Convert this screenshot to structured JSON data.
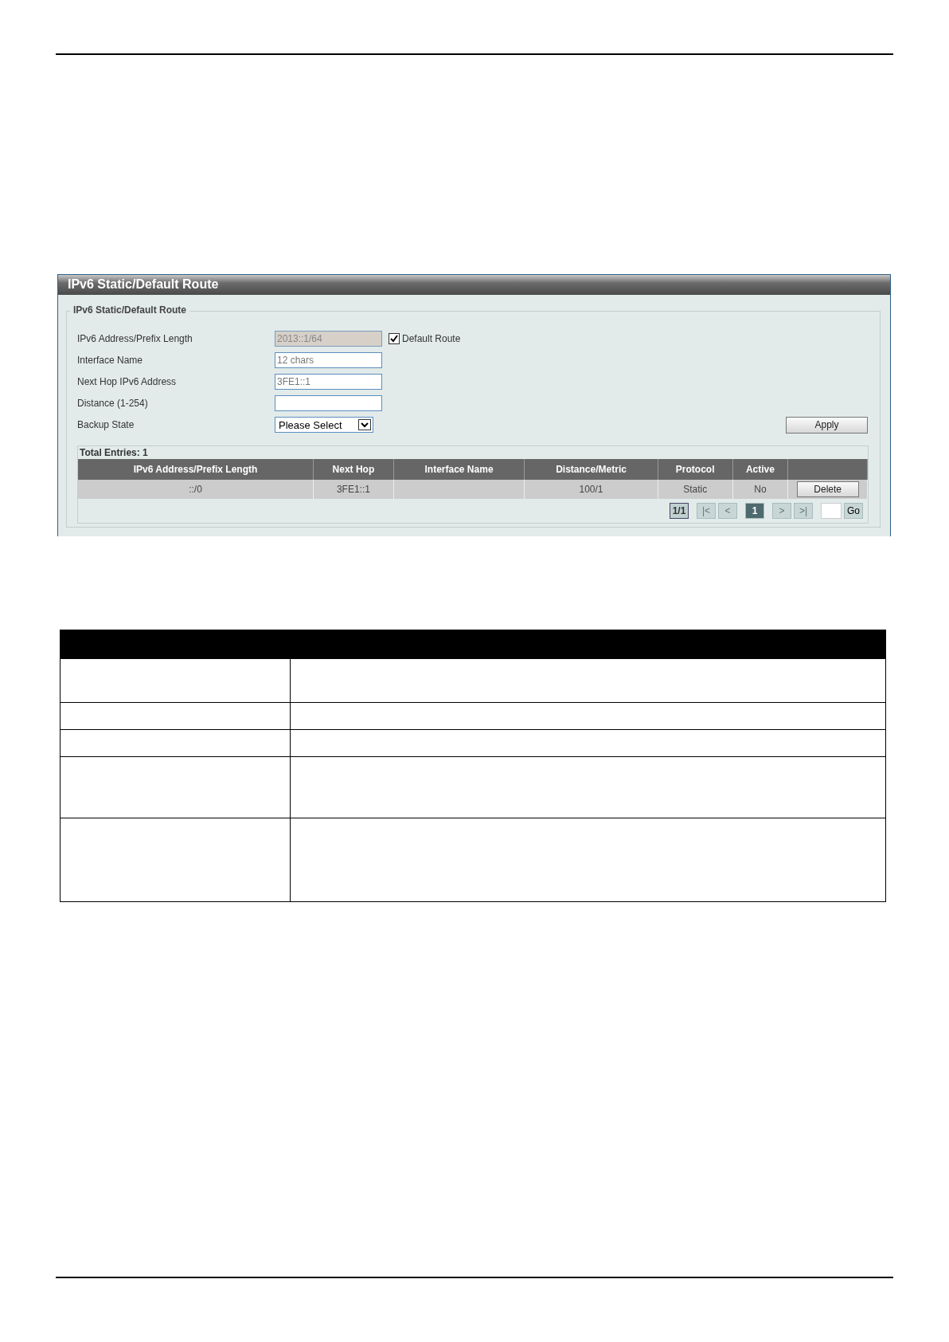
{
  "panel": {
    "title": "IPv6 Static/Default Route",
    "legend": "IPv6 Static/Default Route",
    "fields": [
      {
        "kind": "text",
        "label": "IPv6 Address/Prefix Length",
        "value": "2013::1/64",
        "disabled": true,
        "checkbox": {
          "label": "Default Route",
          "checked": true
        }
      },
      {
        "kind": "text",
        "label": "Interface Name",
        "placeholder": "12 chars",
        "disabled": false
      },
      {
        "kind": "text",
        "label": "Next Hop IPv6 Address",
        "placeholder": "3FE1::1",
        "disabled": false
      },
      {
        "kind": "text",
        "label": "Distance (1-254)",
        "disabled": false
      },
      {
        "kind": "select",
        "label": "Backup State",
        "value": "Please Select"
      }
    ],
    "apply": "Apply",
    "total_entries": "Total Entries: 1",
    "table": {
      "columns": [
        "IPv6 Address/Prefix Length",
        "Next Hop",
        "Interface Name",
        "Distance/Metric",
        "Protocol",
        "Active",
        ""
      ],
      "rows": [
        {
          "cells": [
            "::/0",
            "3FE1::1",
            "",
            "100/1",
            "Static",
            "No"
          ],
          "action": "Delete"
        }
      ]
    },
    "pager": {
      "page_count": "1/1",
      "first": "|<",
      "prev": "<",
      "pages": [
        {
          "label": "1",
          "selected": true
        }
      ],
      "next": ">",
      "last": ">|",
      "go": "Go"
    }
  }
}
